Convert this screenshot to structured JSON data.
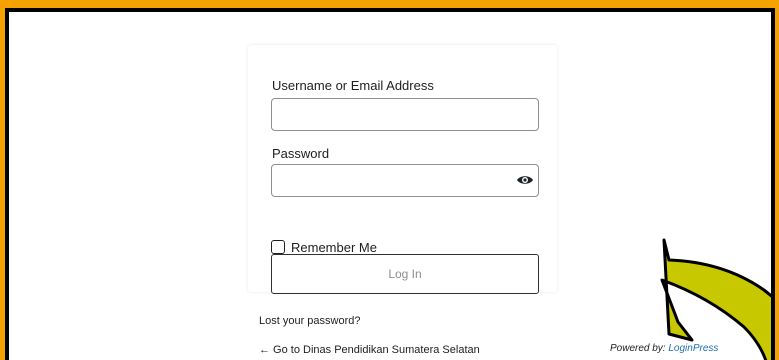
{
  "login_form": {
    "username_label": "Username or Email Address",
    "username_value": "",
    "password_label": "Password",
    "password_value": "",
    "show_password_icon": "eye-icon",
    "remember_label": "Remember Me",
    "remember_checked": false,
    "login_button_label": "Log In"
  },
  "links": {
    "lost_password": "Lost your password?",
    "back_to_site": "← Go to Dinas Pendidikan Sumatera Selatan"
  },
  "footer": {
    "powered_by_prefix": "Powered by:",
    "powered_by_link": "LoginPress"
  },
  "colors": {
    "page_border": "#f5a200",
    "arrow_fill": "#c8c800",
    "link_blue": "#2271b1"
  }
}
